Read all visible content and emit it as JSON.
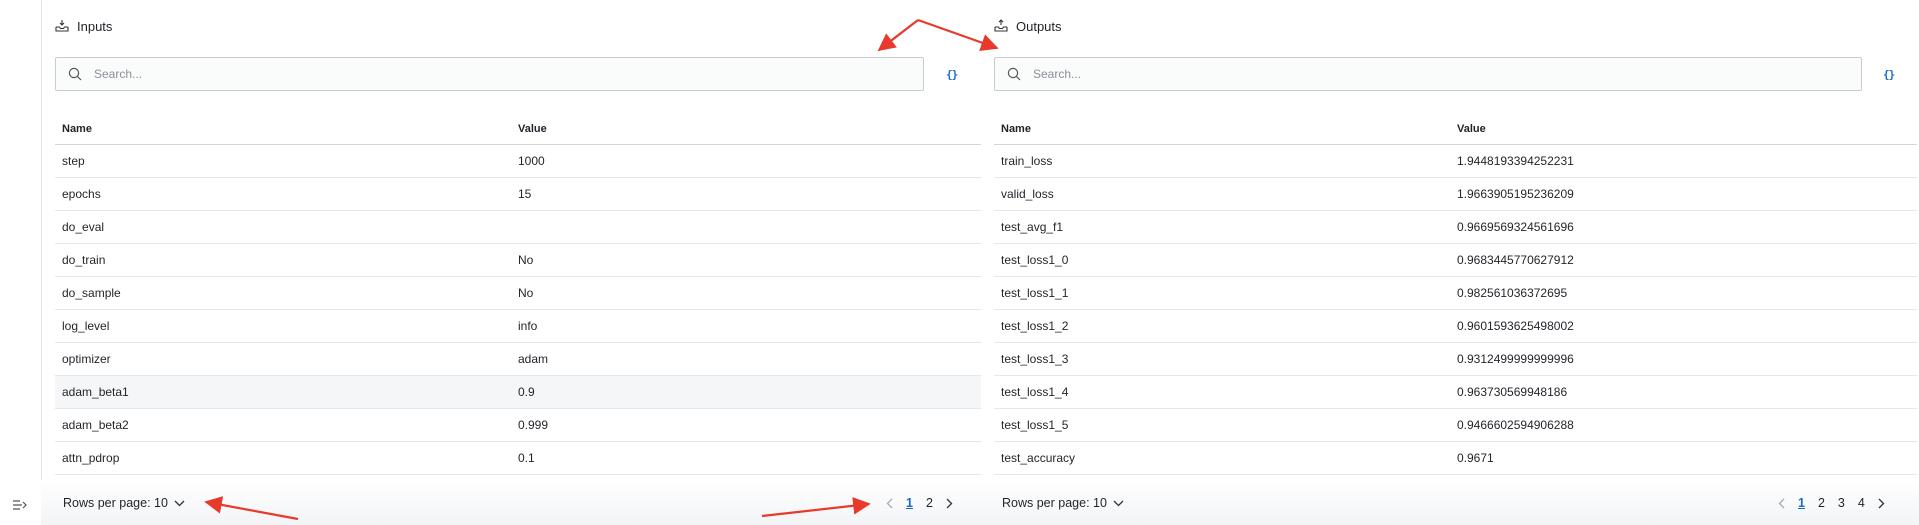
{
  "colors": {
    "accent": "#1a69c4",
    "annotation_arrow": "#e8392b",
    "border": "#c9ccd1",
    "rail_border": "#e3e5e8"
  },
  "left_rail": {
    "toggle_icon": "collapse-panel-icon"
  },
  "inputs": {
    "title": "Inputs",
    "icon": "inputs-tray-icon",
    "search_placeholder": "Search...",
    "json_toggle": "{}",
    "columns": [
      "Name",
      "Value"
    ],
    "rows": [
      {
        "name": "step",
        "value": "1000"
      },
      {
        "name": "epochs",
        "value": "15"
      },
      {
        "name": "do_eval",
        "value": ""
      },
      {
        "name": "do_train",
        "value": "No"
      },
      {
        "name": "do_sample",
        "value": "No"
      },
      {
        "name": "log_level",
        "value": "info"
      },
      {
        "name": "optimizer",
        "value": "adam"
      },
      {
        "name": "adam_beta1",
        "value": "0.9"
      },
      {
        "name": "adam_beta2",
        "value": "0.999"
      },
      {
        "name": "attn_pdrop",
        "value": "0.1"
      }
    ],
    "rows_per_page_label": "Rows per page: 10",
    "pages": [
      "1",
      "2"
    ],
    "current_page": "1"
  },
  "outputs": {
    "title": "Outputs",
    "icon": "outputs-tray-icon",
    "search_placeholder": "Search...",
    "json_toggle": "{}",
    "columns": [
      "Name",
      "Value"
    ],
    "rows": [
      {
        "name": "train_loss",
        "value": "1.9448193394252231"
      },
      {
        "name": "valid_loss",
        "value": "1.9663905195236209"
      },
      {
        "name": "test_avg_f1",
        "value": "0.9669569324561696"
      },
      {
        "name": "test_loss1_0",
        "value": "0.9683445770627912"
      },
      {
        "name": "test_loss1_1",
        "value": "0.982561036372695"
      },
      {
        "name": "test_loss1_2",
        "value": "0.9601593625498002"
      },
      {
        "name": "test_loss1_3",
        "value": "0.9312499999999996"
      },
      {
        "name": "test_loss1_4",
        "value": "0.963730569948186"
      },
      {
        "name": "test_loss1_5",
        "value": "0.9466602594906288"
      },
      {
        "name": "test_accuracy",
        "value": "0.9671"
      }
    ],
    "rows_per_page_label": "Rows per page: 10",
    "pages": [
      "1",
      "2",
      "3",
      "4"
    ],
    "current_page": "1"
  }
}
